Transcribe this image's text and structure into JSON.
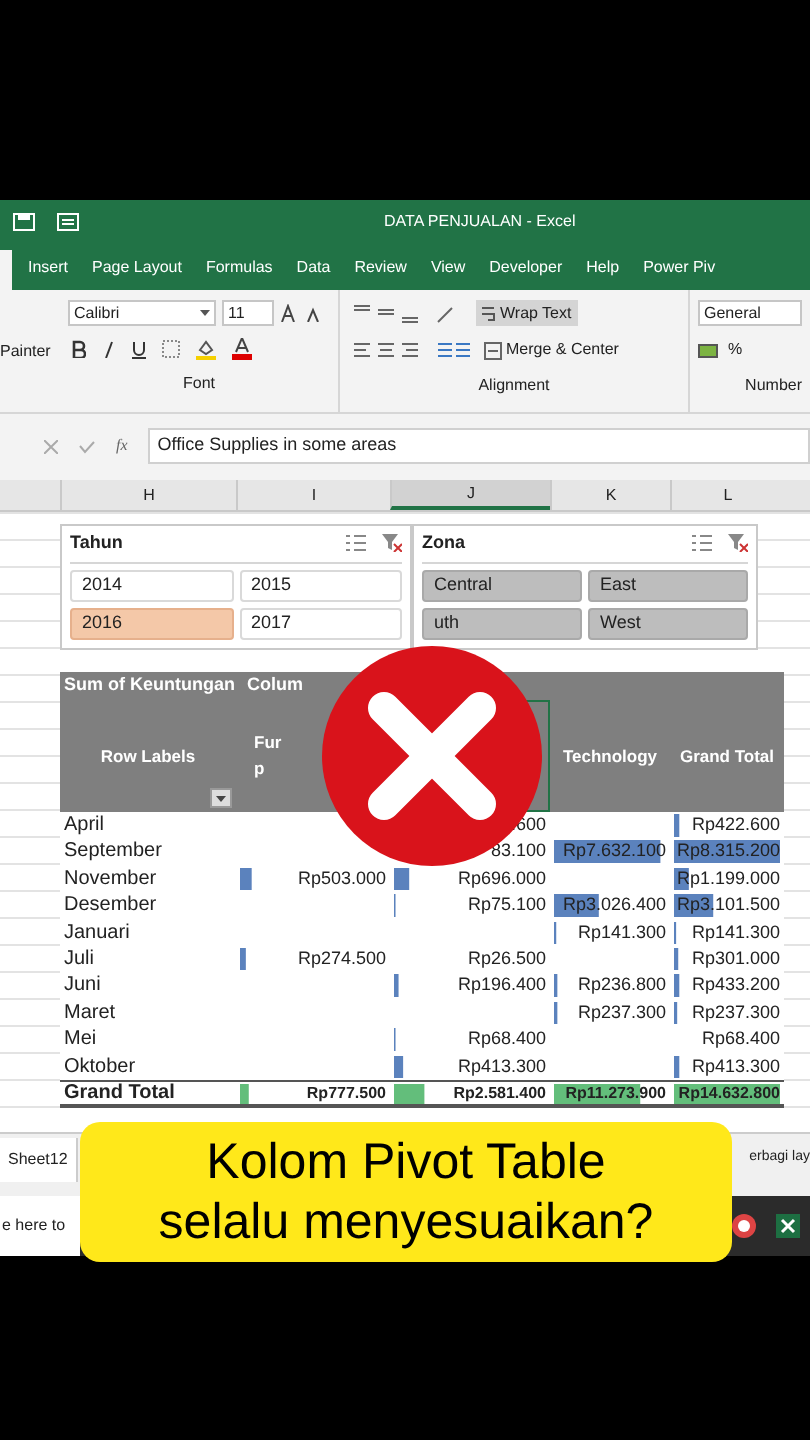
{
  "window": {
    "title": "DATA PENJUALAN  -  Excel"
  },
  "ribbon_tabs": [
    "Insert",
    "Page Layout",
    "Formulas",
    "Data",
    "Review",
    "View",
    "Developer",
    "Help",
    "Power Piv"
  ],
  "ribbon": {
    "clipboard_label": "Painter",
    "font_name": "Calibri",
    "font_size": "11",
    "font_group": "Font",
    "wrap_text": "Wrap Text",
    "merge": "Merge & Center",
    "alignment_group": "Alignment",
    "number_format": "General",
    "percent": "%",
    "number_group": "Number"
  },
  "formula_bar": {
    "function_label": "fx",
    "value": "Office Supplies in some areas"
  },
  "columns": [
    {
      "label": "H",
      "selected": false
    },
    {
      "label": "I",
      "selected": false
    },
    {
      "label": "J",
      "selected": true
    },
    {
      "label": "K",
      "selected": false
    },
    {
      "label": "L",
      "selected": false
    }
  ],
  "slicers": [
    {
      "title": "Tahun",
      "kind": "warm",
      "items": [
        {
          "label": "2014",
          "selected": false
        },
        {
          "label": "2015",
          "selected": false
        },
        {
          "label": "2016",
          "selected": true
        },
        {
          "label": "2017",
          "selected": false
        }
      ]
    },
    {
      "title": "Zona",
      "kind": "neutral",
      "items": [
        {
          "label": "Central",
          "selected": true
        },
        {
          "label": "East",
          "selected": true
        },
        {
          "label": "uth",
          "selected": true
        },
        {
          "label": "West",
          "selected": true
        }
      ]
    }
  ],
  "pivot": {
    "value_field": "Sum of Keuntungan",
    "column_field": "Colum",
    "row_labels": "Row Labels",
    "header_i": [
      "Fur",
      "p"
    ],
    "header_k": "Technology",
    "header_l": "Grand Total",
    "rows": [
      {
        "label": "April",
        "cells": [
          null,
          {
            "text": ".600"
          },
          null,
          {
            "text": "Rp422.600",
            "level": 0.05
          }
        ]
      },
      {
        "label": "September",
        "cells": [
          null,
          {
            "text": "83.100"
          },
          {
            "text": "Rp7.632.100",
            "level": 0.95
          },
          {
            "text": "Rp8.315.200",
            "level": 1
          }
        ]
      },
      {
        "label": "November",
        "cells": [
          {
            "text": "Rp503.000",
            "level": 0.08
          },
          {
            "text": "Rp696.000",
            "level": 0.1
          },
          null,
          {
            "text": "Rp1.199.000",
            "level": 0.14
          }
        ]
      },
      {
        "label": "Desember",
        "cells": [
          null,
          {
            "text": "Rp75.100",
            "level": 0.01
          },
          {
            "text": "Rp3.026.400",
            "level": 0.4
          },
          {
            "text": "Rp3.101.500",
            "level": 0.37
          }
        ]
      },
      {
        "label": "Januari",
        "cells": [
          null,
          null,
          {
            "text": "Rp141.300",
            "level": 0.02
          },
          {
            "text": "Rp141.300",
            "level": 0.02
          }
        ]
      },
      {
        "label": "Juli",
        "cells": [
          {
            "text": "Rp274.500",
            "level": 0.04
          },
          {
            "text": "Rp26.500"
          },
          null,
          {
            "text": "Rp301.000",
            "level": 0.04
          }
        ]
      },
      {
        "label": "Juni",
        "cells": [
          null,
          {
            "text": "Rp196.400",
            "level": 0.03
          },
          {
            "text": "Rp236.800",
            "level": 0.03
          },
          {
            "text": "Rp433.200",
            "level": 0.05
          }
        ]
      },
      {
        "label": "Maret",
        "cells": [
          null,
          null,
          {
            "text": "Rp237.300",
            "level": 0.03
          },
          {
            "text": "Rp237.300",
            "level": 0.03
          }
        ]
      },
      {
        "label": "Mei",
        "cells": [
          null,
          {
            "text": "Rp68.400",
            "level": 0.01
          },
          null,
          {
            "text": "Rp68.400"
          }
        ]
      },
      {
        "label": "Oktober",
        "cells": [
          null,
          {
            "text": "Rp413.300",
            "level": 0.06
          },
          null,
          {
            "text": "Rp413.300",
            "level": 0.05
          }
        ]
      }
    ],
    "total": {
      "label": "Grand Total",
      "cells": [
        {
          "text": "Rp777.500",
          "level": 0.06
        },
        {
          "text": "Rp2.581.400",
          "level": 0.2
        },
        {
          "text": "Rp11.273.900",
          "level": 0.77
        },
        {
          "text": "Rp14.632.800",
          "level": 1
        }
      ]
    }
  },
  "sheet_tab": "Sheet12",
  "status_text": "erbagi lay",
  "taskbar": {
    "search_placeholder": "e here to"
  },
  "caption": [
    "Kolom Pivot Table",
    "selalu menyesuaikan?"
  ]
}
